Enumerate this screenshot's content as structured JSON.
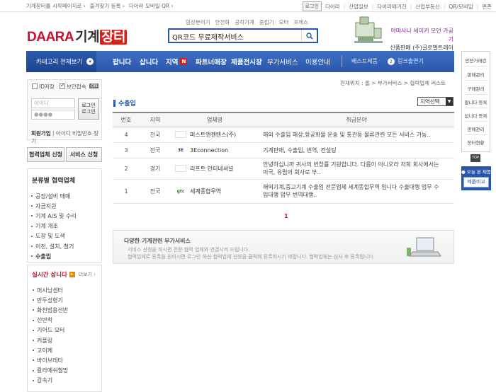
{
  "topbar": {
    "left_links": [
      "기계장터를 시작페이지로 ›",
      "즐겨찾기 등록 ›",
      "다아라 모바일 QR ›"
    ],
    "login": "로그인",
    "right_links": [
      "다아라",
      "산업일보",
      "다아라매거진",
      "산업부동산",
      "QR/모바일",
      "편존"
    ]
  },
  "header": {
    "logo_daara": "DAARA",
    "logo_gige": "기계",
    "logo_jangter": "장터",
    "links": [
      "임상분리기",
      "안전화",
      "공작기계",
      "중접기",
      "모터",
      "프레스"
    ],
    "search_value": "QR코드 무료제작서비스",
    "banner_line1": "야마사나 세이키 모던 가공기",
    "banner_line2": "신품판매 (주)글로벌트레이딩리더"
  },
  "nav": {
    "category_all": "카테고리 전체보기",
    "items": [
      {
        "label": "팝니다"
      },
      {
        "label": "삽니다"
      },
      {
        "label": "지역",
        "badge": "N"
      },
      {
        "label": "파트너매장"
      },
      {
        "label": "제품전시장"
      },
      {
        "label": "부가서비스",
        "light": true
      },
      {
        "label": "이용안내",
        "light": true
      }
    ],
    "best": "베스트제품",
    "link_num": "2",
    "link_label": "링크출연기"
  },
  "login": {
    "id_save": "ID저장",
    "secure": "보안접속",
    "secure_badge": "ON",
    "id_placeholder": "아이디",
    "pw_placeholder": "●●●●",
    "button_line1": "로그인",
    "button_line2": "로그인",
    "join": "회원가입",
    "find": "아이디 비밀번호 찾기"
  },
  "partner": {
    "apply": "협력업체 신청",
    "service": "서비스 신청"
  },
  "categories": {
    "title": "분류별 협력업체",
    "items": [
      "공장/설비 매매",
      "자금지원",
      "기계 A/S 및 수리",
      "기계 개조",
      "도장 및 도색",
      "이전, 설치, 철거",
      "수출입"
    ]
  },
  "realtime": {
    "title": "실시간 삽니다",
    "more": "더보기 ›",
    "items": [
      "머시닝센터",
      "만두성형기",
      "화천범용선반",
      "선반척",
      "기어드 모터",
      "커플링",
      "고이케",
      "바이브레타",
      "칼라메쉬철망",
      "감속기"
    ]
  },
  "breadcrumb": "현재위치 : 홈 > 부가서비스 > 협력업체 리스트",
  "section": {
    "title": "수출입",
    "region_select": "지역선택"
  },
  "table": {
    "headers": [
      "번호",
      "지역",
      "업체명",
      "취급분야"
    ],
    "rows": [
      {
        "no": "4",
        "region": "전국",
        "logo": "",
        "company": "퍼스트엔젠텐스(주)",
        "field": [
          "해외 수출입 해상,항공화물 운송 및 통관등 물류관련 모든 서비스 가능.."
        ]
      },
      {
        "no": "3",
        "region": "전국",
        "logo": "3E",
        "company": "3Econnection",
        "field": [
          "기계판매, 수출입, 번역, 컨설팅"
        ]
      },
      {
        "no": "2",
        "region": "경기",
        "logo": "",
        "company": "리프트 인터네셔널",
        "field": [
          "안녕하십니까 귀사의 번창를 기원합니다. 다름이 아니오라 저희 회사에서는",
          "미국, 유럽의 회사로 부.."
        ]
      },
      {
        "no": "1",
        "region": "전국",
        "logo": "gtc",
        "company": "세계종합무역",
        "field": [
          "해외기계,중고기계 수출입 전문업체 세계종합무역 입니다 수출대행 업무 수",
          "입대행 업무 번역대행.."
        ]
      }
    ]
  },
  "pagination": {
    "current": "1"
  },
  "addon": {
    "title": "다양한 기계관련 부가서비스",
    "line1": "서비스 신청을 하시면 전문 협력 업체와 연결시켜 드립니다.",
    "line2": "협력업체로 등록을 원하시면 로그인 하신 협력업체 신청을 클릭해 등록하시기 바랍니다. 협력업체는 심사 후 등록됩니다."
  },
  "quick_menu": {
    "items": [
      "안전거래란",
      "판매관리",
      "구매관리",
      "팝니다 등록",
      "삽니다 등록",
      "판매관리",
      "장터현황"
    ],
    "top": "TOP",
    "today_label": "● 오늘 본 제품",
    "compare": "제품비교"
  },
  "colors": {
    "brand_red": "#c8102e",
    "nav_blue": "#2a57a9"
  }
}
